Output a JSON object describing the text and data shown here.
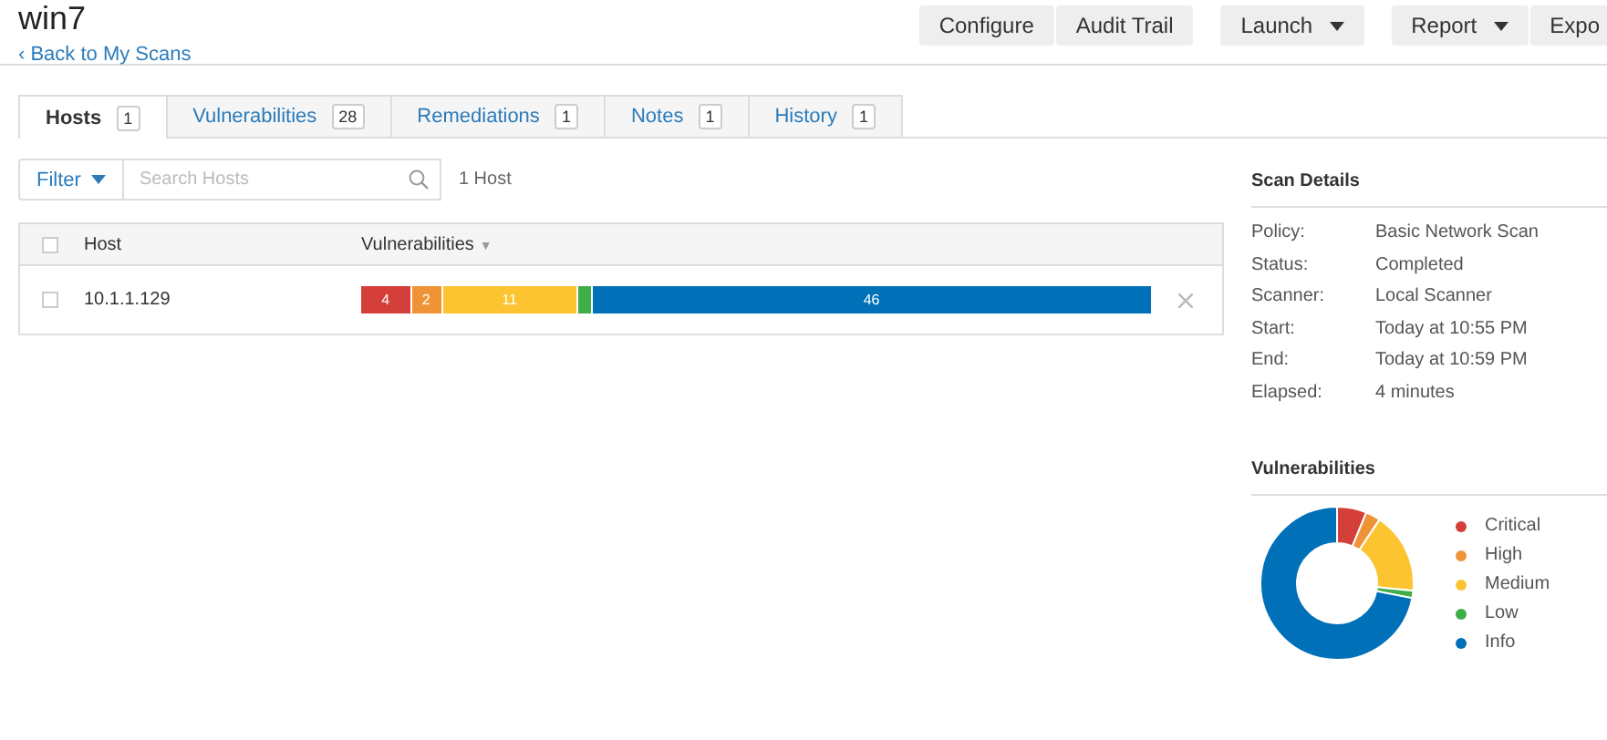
{
  "title": "win7",
  "back_link": "‹ Back to My Scans",
  "toolbar": [
    {
      "buttons": [
        {
          "label": "Configure",
          "dropdown": false
        },
        {
          "label": "Audit Trail",
          "dropdown": false
        }
      ]
    },
    {
      "buttons": [
        {
          "label": "Launch",
          "dropdown": true
        }
      ]
    },
    {
      "buttons": [
        {
          "label": "Report",
          "dropdown": true
        },
        {
          "label": "Expo",
          "dropdown": false
        }
      ]
    }
  ],
  "tabs": [
    {
      "label": "Hosts",
      "count": "1",
      "selected": true
    },
    {
      "label": "Vulnerabilities",
      "count": "28",
      "selected": false
    },
    {
      "label": "Remediations",
      "count": "1",
      "selected": false
    },
    {
      "label": "Notes",
      "count": "1",
      "selected": false
    },
    {
      "label": "History",
      "count": "1",
      "selected": false
    }
  ],
  "filter": {
    "label": "Filter",
    "placeholder": "Search Hosts",
    "result_count": "1 Host"
  },
  "table": {
    "columns": [
      {
        "label": "Host"
      },
      {
        "label": "Vulnerabilities",
        "sort": "▼"
      }
    ],
    "checked": false,
    "rows": [
      {
        "host": "10.1.1.129",
        "checked": false,
        "segments": [
          {
            "label": "4",
            "color": "#d43f3a"
          },
          {
            "label": "2",
            "color": "#ee9336"
          },
          {
            "label": "11",
            "color": "#fdc431"
          },
          {
            "color": "#3fae49"
          },
          {
            "label": "46",
            "color": "#0071b9"
          }
        ]
      }
    ]
  },
  "scan_details": {
    "title": "Scan Details",
    "rows": [
      {
        "label": "Policy:",
        "value": "Basic Network Scan"
      },
      {
        "label": "Status:",
        "value": "Completed"
      },
      {
        "label": "Scanner:",
        "value": "Local Scanner"
      },
      {
        "label": "Start:",
        "value": "Today at 10:55 PM"
      },
      {
        "label": "End:",
        "value": "Today at 10:59 PM"
      },
      {
        "label": "Elapsed:",
        "value": "4 minutes"
      }
    ]
  },
  "vulnerabilities_panel": {
    "title": "Vulnerabilities",
    "chart_data": {
      "type": "donut",
      "legend": "right",
      "categories": [
        "Critical",
        "High",
        "Medium",
        "Low",
        "Info"
      ],
      "values": [
        6.25,
        3.125,
        17.1875,
        1.5625,
        71.875
      ],
      "colors": [
        "#d43f3a",
        "#ee9336",
        "#fdc431",
        "#3fae49",
        "#0071b9"
      ]
    }
  }
}
